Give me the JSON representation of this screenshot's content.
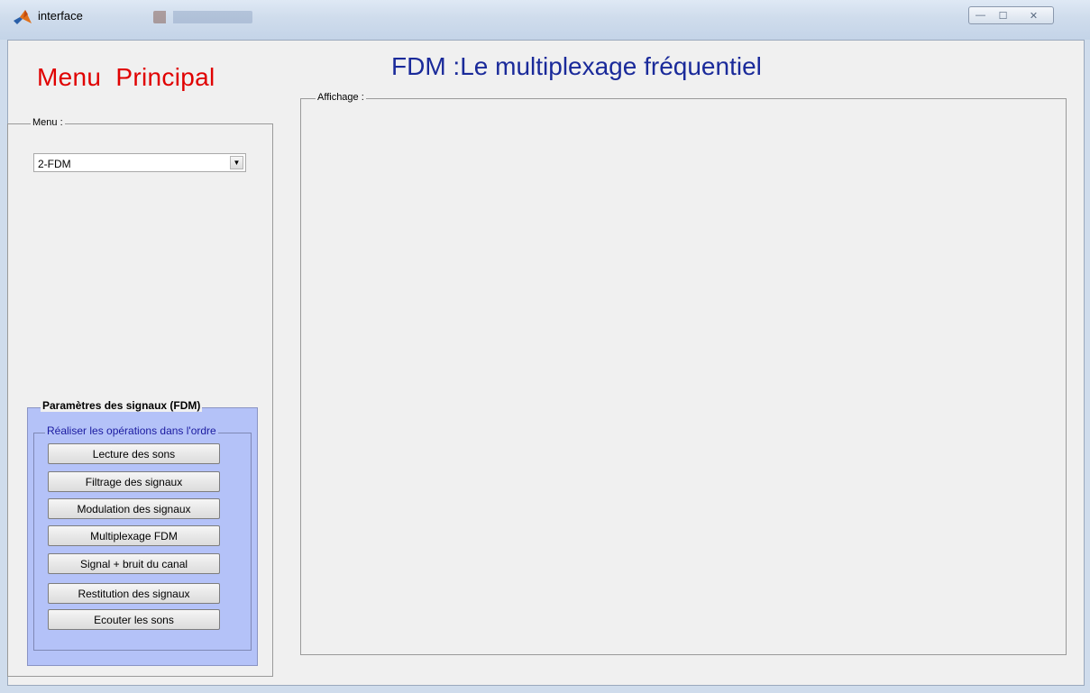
{
  "window": {
    "title": "interface",
    "controls": {
      "minimize": "—",
      "maximize": "☐",
      "close": "✕"
    }
  },
  "menu_title": "Menu  Principal",
  "main_title": "FDM :Le multiplexage fréquentiel",
  "menu_panel": {
    "label": "Menu :",
    "select": {
      "value": "2-FDM",
      "arrow": "▼"
    }
  },
  "params_panel": {
    "label": "Paramètres des signaux (FDM)",
    "ordre_label": "Réaliser les opérations dans l'ordre",
    "buttons": [
      "Lecture des sons",
      "Filtrage des signaux",
      "Modulation des signaux",
      "Multiplexage FDM",
      "Signal + bruit du canal",
      "Restitution des signaux",
      "Ecouter les sons"
    ]
  },
  "affichage_panel": {
    "label": "Affichage :"
  },
  "colors": {
    "menu_title": "#e00000",
    "main_title": "#1a2a9a",
    "params_bg": "#b4c2f8"
  }
}
